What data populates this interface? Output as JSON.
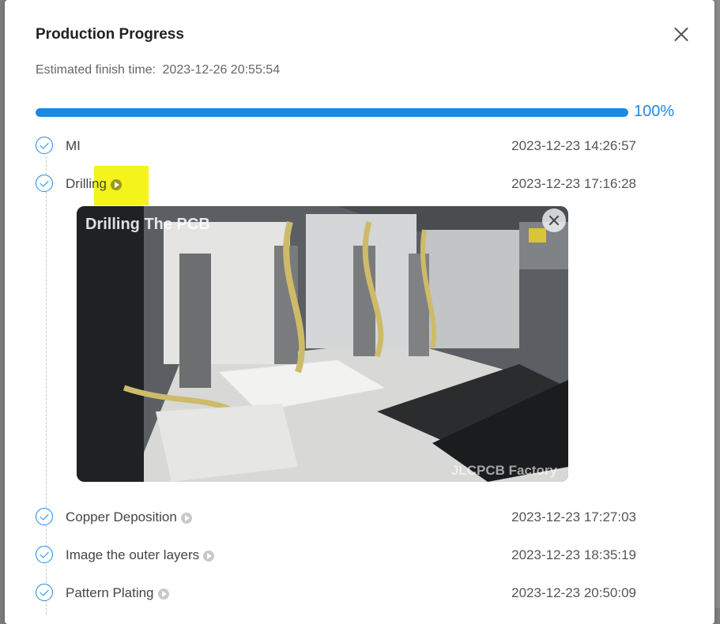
{
  "dialog": {
    "title": "Production Progress",
    "estimate_label": "Estimated finish time:",
    "estimate_value": "2023-12-26 20:55:54",
    "progress_value": 100,
    "progress_text": "100%"
  },
  "steps": [
    {
      "label": "MI",
      "time": "2023-12-23 14:26:57"
    },
    {
      "label": "Drilling",
      "time": "2023-12-23 17:16:28"
    },
    {
      "label": "Copper Deposition",
      "time": "2023-12-23 17:27:03"
    },
    {
      "label": "Image the outer layers",
      "time": "2023-12-23 18:35:19"
    },
    {
      "label": "Pattern Plating",
      "time": "2023-12-23 20:50:09"
    }
  ],
  "video": {
    "overlay_title": "Drilling  The PCB",
    "watermark": "JLCPCB  Factory"
  },
  "colors": {
    "accent": "#1e88e5",
    "highlight": "#f4f41c"
  }
}
